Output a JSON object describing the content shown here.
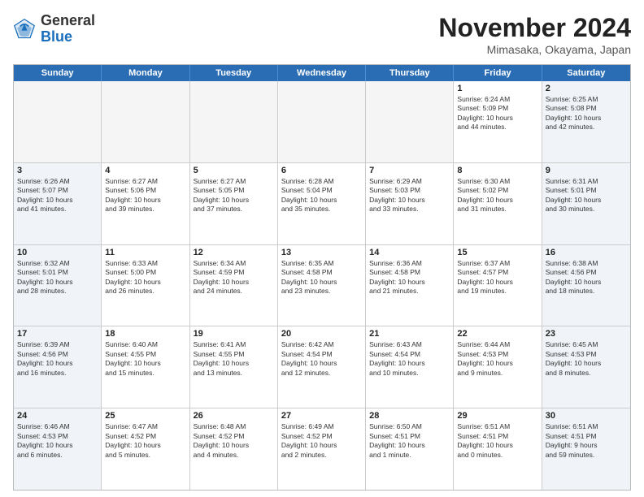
{
  "logo": {
    "general": "General",
    "blue": "Blue"
  },
  "header": {
    "month_title": "November 2024",
    "location": "Mimasaka, Okayama, Japan"
  },
  "weekdays": [
    "Sunday",
    "Monday",
    "Tuesday",
    "Wednesday",
    "Thursday",
    "Friday",
    "Saturday"
  ],
  "rows": [
    [
      {
        "day": "",
        "info": "",
        "empty": true
      },
      {
        "day": "",
        "info": "",
        "empty": true
      },
      {
        "day": "",
        "info": "",
        "empty": true
      },
      {
        "day": "",
        "info": "",
        "empty": true
      },
      {
        "day": "",
        "info": "",
        "empty": true
      },
      {
        "day": "1",
        "info": "Sunrise: 6:24 AM\nSunset: 5:09 PM\nDaylight: 10 hours\nand 44 minutes."
      },
      {
        "day": "2",
        "info": "Sunrise: 6:25 AM\nSunset: 5:08 PM\nDaylight: 10 hours\nand 42 minutes."
      }
    ],
    [
      {
        "day": "3",
        "info": "Sunrise: 6:26 AM\nSunset: 5:07 PM\nDaylight: 10 hours\nand 41 minutes."
      },
      {
        "day": "4",
        "info": "Sunrise: 6:27 AM\nSunset: 5:06 PM\nDaylight: 10 hours\nand 39 minutes."
      },
      {
        "day": "5",
        "info": "Sunrise: 6:27 AM\nSunset: 5:05 PM\nDaylight: 10 hours\nand 37 minutes."
      },
      {
        "day": "6",
        "info": "Sunrise: 6:28 AM\nSunset: 5:04 PM\nDaylight: 10 hours\nand 35 minutes."
      },
      {
        "day": "7",
        "info": "Sunrise: 6:29 AM\nSunset: 5:03 PM\nDaylight: 10 hours\nand 33 minutes."
      },
      {
        "day": "8",
        "info": "Sunrise: 6:30 AM\nSunset: 5:02 PM\nDaylight: 10 hours\nand 31 minutes."
      },
      {
        "day": "9",
        "info": "Sunrise: 6:31 AM\nSunset: 5:01 PM\nDaylight: 10 hours\nand 30 minutes."
      }
    ],
    [
      {
        "day": "10",
        "info": "Sunrise: 6:32 AM\nSunset: 5:01 PM\nDaylight: 10 hours\nand 28 minutes."
      },
      {
        "day": "11",
        "info": "Sunrise: 6:33 AM\nSunset: 5:00 PM\nDaylight: 10 hours\nand 26 minutes."
      },
      {
        "day": "12",
        "info": "Sunrise: 6:34 AM\nSunset: 4:59 PM\nDaylight: 10 hours\nand 24 minutes."
      },
      {
        "day": "13",
        "info": "Sunrise: 6:35 AM\nSunset: 4:58 PM\nDaylight: 10 hours\nand 23 minutes."
      },
      {
        "day": "14",
        "info": "Sunrise: 6:36 AM\nSunset: 4:58 PM\nDaylight: 10 hours\nand 21 minutes."
      },
      {
        "day": "15",
        "info": "Sunrise: 6:37 AM\nSunset: 4:57 PM\nDaylight: 10 hours\nand 19 minutes."
      },
      {
        "day": "16",
        "info": "Sunrise: 6:38 AM\nSunset: 4:56 PM\nDaylight: 10 hours\nand 18 minutes."
      }
    ],
    [
      {
        "day": "17",
        "info": "Sunrise: 6:39 AM\nSunset: 4:56 PM\nDaylight: 10 hours\nand 16 minutes."
      },
      {
        "day": "18",
        "info": "Sunrise: 6:40 AM\nSunset: 4:55 PM\nDaylight: 10 hours\nand 15 minutes."
      },
      {
        "day": "19",
        "info": "Sunrise: 6:41 AM\nSunset: 4:55 PM\nDaylight: 10 hours\nand 13 minutes."
      },
      {
        "day": "20",
        "info": "Sunrise: 6:42 AM\nSunset: 4:54 PM\nDaylight: 10 hours\nand 12 minutes."
      },
      {
        "day": "21",
        "info": "Sunrise: 6:43 AM\nSunset: 4:54 PM\nDaylight: 10 hours\nand 10 minutes."
      },
      {
        "day": "22",
        "info": "Sunrise: 6:44 AM\nSunset: 4:53 PM\nDaylight: 10 hours\nand 9 minutes."
      },
      {
        "day": "23",
        "info": "Sunrise: 6:45 AM\nSunset: 4:53 PM\nDaylight: 10 hours\nand 8 minutes."
      }
    ],
    [
      {
        "day": "24",
        "info": "Sunrise: 6:46 AM\nSunset: 4:53 PM\nDaylight: 10 hours\nand 6 minutes."
      },
      {
        "day": "25",
        "info": "Sunrise: 6:47 AM\nSunset: 4:52 PM\nDaylight: 10 hours\nand 5 minutes."
      },
      {
        "day": "26",
        "info": "Sunrise: 6:48 AM\nSunset: 4:52 PM\nDaylight: 10 hours\nand 4 minutes."
      },
      {
        "day": "27",
        "info": "Sunrise: 6:49 AM\nSunset: 4:52 PM\nDaylight: 10 hours\nand 2 minutes."
      },
      {
        "day": "28",
        "info": "Sunrise: 6:50 AM\nSunset: 4:51 PM\nDaylight: 10 hours\nand 1 minute."
      },
      {
        "day": "29",
        "info": "Sunrise: 6:51 AM\nSunset: 4:51 PM\nDaylight: 10 hours\nand 0 minutes."
      },
      {
        "day": "30",
        "info": "Sunrise: 6:51 AM\nSunset: 4:51 PM\nDaylight: 9 hours\nand 59 minutes."
      }
    ]
  ]
}
